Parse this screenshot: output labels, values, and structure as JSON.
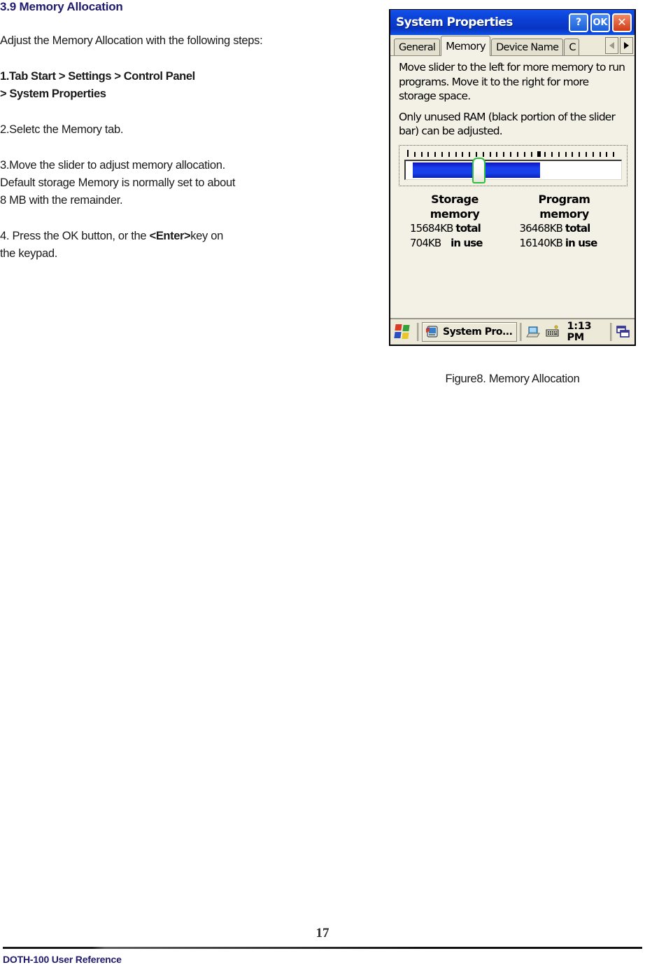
{
  "document": {
    "heading": "3.9 Memory Allocation",
    "intro": "Adjust the Memory Allocation with the following steps:",
    "steps": [
      {
        "line1": "1.Tab Start > Settings > Control Panel",
        "line2": " > System Properties",
        "bold": true
      },
      {
        "line1": "2.Seletc the Memory tab.",
        "bold": false
      },
      {
        "line1": "3.Move the slider to adjust memory allocation.",
        "line2": "Default storage Memory is normally set to about",
        "line3": "8 MB with the remainder.",
        "bold": false
      },
      {
        "pre": "4. Press the OK button, or the ",
        "strong": "<Enter>",
        "post": "key on",
        "line2": "the keypad.",
        "bold": false
      }
    ],
    "figure_caption": "Figure8. Memory Allocation"
  },
  "dialog": {
    "title": "System Properties",
    "title_buttons": {
      "help": "?",
      "ok": "OK",
      "close": "✕"
    },
    "tabs": [
      {
        "label": "General",
        "active": false
      },
      {
        "label": "Memory",
        "active": true
      },
      {
        "label": "Device Name",
        "active": false
      },
      {
        "label": "C",
        "active": false,
        "clipped": true
      }
    ],
    "tab_scroll": {
      "left": "◀",
      "right": "▶"
    },
    "instructions": [
      "Move slider to the left for more memory to run programs. Move it to the right for more storage space.",
      "Only unused RAM (black portion of the slider bar) can be adjusted."
    ],
    "slider": {
      "fill_percent": 59,
      "thumb_percent": 31
    },
    "memory": {
      "storage": {
        "title_line1": "Storage",
        "title_line2": "memory",
        "total_value": "15684KB",
        "total_label": "total",
        "inuse_value": "704KB",
        "inuse_label": "in use"
      },
      "program": {
        "title_line1": "Program",
        "title_line2": "memory",
        "total_value": "36468KB",
        "total_label": "total",
        "inuse_value": "16140KB",
        "inuse_label": "in use"
      }
    },
    "taskbar": {
      "start_icon": "windows-flag-icon",
      "task_button": "System Pro...",
      "task_icon": "system-properties-icon",
      "tray_desktop_icon": "desktop-pc-icon",
      "tray_keyboard_icon": "soft-keyboard-icon",
      "time": "1:13 PM",
      "window_stack_icon": "window-stack-icon"
    }
  },
  "footer": {
    "page_number": "17",
    "reference": "DOTH-100 User Reference"
  },
  "colors": {
    "heading_blue": "#1f1a6e",
    "titlebar_blue": "#0b3fd4",
    "slider_blue": "#1a3fef",
    "thumb_green": "#2fbf3d",
    "panel_bg": "#f3f1e6",
    "chrome_bg": "#ece9d8"
  }
}
